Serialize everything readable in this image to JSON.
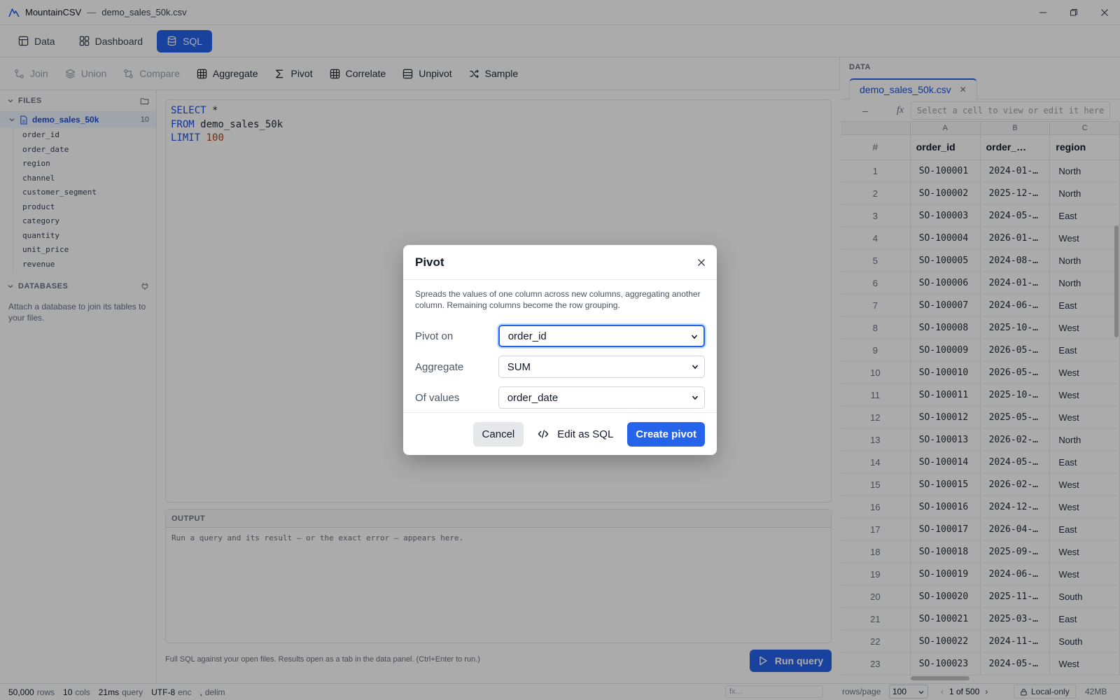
{
  "titlebar": {
    "app_name": "MountainCSV",
    "separator": "—",
    "file_name": "demo_sales_50k.csv"
  },
  "main_tabs": [
    {
      "label": "Data",
      "icon": "table-icon",
      "active": false
    },
    {
      "label": "Dashboard",
      "icon": "dashboard-icon",
      "active": false
    },
    {
      "label": "SQL",
      "icon": "database-icon",
      "active": true
    }
  ],
  "toolbar": {
    "join": "Join",
    "union": "Union",
    "compare": "Compare",
    "aggregate": "Aggregate",
    "pivot": "Pivot",
    "correlate": "Correlate",
    "unpivot": "Unpivot",
    "sample": "Sample"
  },
  "sidebar": {
    "files_header": "FILES",
    "file": {
      "name": "demo_sales_50k",
      "count": "10"
    },
    "columns": [
      "order_id",
      "order_date",
      "region",
      "channel",
      "customer_segment",
      "product",
      "category",
      "quantity",
      "unit_price",
      "revenue"
    ],
    "databases_header": "DATABASES",
    "databases_note": "Attach a database to join its tables to your files."
  },
  "editor": {
    "line1_kw": "SELECT",
    "line1_rest": " *",
    "line2_kw": "FROM",
    "line2_rest": " demo_sales_50k",
    "line3_kw": "LIMIT",
    "line3_num": "100"
  },
  "output": {
    "header": "OUTPUT",
    "empty_text": "Run a query and its result — or the exact error — appears here."
  },
  "hint": "Full SQL against your open files. Results open as a tab in the data panel. (Ctrl+Enter to run.)",
  "run_button": "Run query",
  "data_panel": {
    "header": "DATA",
    "file_tab": "demo_sales_50k.csv",
    "cell_ref": "–",
    "fx": "fx",
    "formula_placeholder": "Select a cell to view or edit it here",
    "col_letters": [
      "A",
      "B",
      "C"
    ],
    "row_header": "#",
    "columns": [
      "order_id",
      "order_…",
      "region"
    ],
    "rows": [
      [
        "1",
        "SO-100001",
        "2024-01-…",
        "North"
      ],
      [
        "2",
        "SO-100002",
        "2025-12-…",
        "North"
      ],
      [
        "3",
        "SO-100003",
        "2024-05-…",
        "East"
      ],
      [
        "4",
        "SO-100004",
        "2026-01-…",
        "West"
      ],
      [
        "5",
        "SO-100005",
        "2024-08-…",
        "North"
      ],
      [
        "6",
        "SO-100006",
        "2024-01-…",
        "North"
      ],
      [
        "7",
        "SO-100007",
        "2024-06-…",
        "East"
      ],
      [
        "8",
        "SO-100008",
        "2025-10-…",
        "West"
      ],
      [
        "9",
        "SO-100009",
        "2026-05-…",
        "East"
      ],
      [
        "10",
        "SO-100010",
        "2026-05-…",
        "West"
      ],
      [
        "11",
        "SO-100011",
        "2025-10-…",
        "West"
      ],
      [
        "12",
        "SO-100012",
        "2025-05-…",
        "West"
      ],
      [
        "13",
        "SO-100013",
        "2026-02-…",
        "North"
      ],
      [
        "14",
        "SO-100014",
        "2024-05-…",
        "East"
      ],
      [
        "15",
        "SO-100015",
        "2026-02-…",
        "West"
      ],
      [
        "16",
        "SO-100016",
        "2024-12-…",
        "West"
      ],
      [
        "17",
        "SO-100017",
        "2026-04-…",
        "East"
      ],
      [
        "18",
        "SO-100018",
        "2025-09-…",
        "West"
      ],
      [
        "19",
        "SO-100019",
        "2024-06-…",
        "West"
      ],
      [
        "20",
        "SO-100020",
        "2025-11-…",
        "South"
      ],
      [
        "21",
        "SO-100021",
        "2025-03-…",
        "East"
      ],
      [
        "22",
        "SO-100022",
        "2024-11-…",
        "South"
      ],
      [
        "23",
        "SO-100023",
        "2024-05-…",
        "West"
      ]
    ]
  },
  "statusbar": {
    "rows_value": "50,000",
    "rows_label": "rows",
    "cols_value": "10",
    "cols_label": "cols",
    "query_value": "21ms",
    "query_label": "query",
    "enc_value": "UTF-8",
    "enc_label": "enc",
    "delim_value": ",",
    "delim_label": "delim",
    "fx_placeholder": "fx…",
    "rows_per_page_label": "rows/page",
    "rows_per_page": "100",
    "page": "1 of 500",
    "local": "Local-only",
    "memory": "42MB"
  },
  "modal": {
    "title": "Pivot",
    "description": "Spreads the values of one column across new columns, aggregating another column. Remaining columns become the row grouping.",
    "pivot_on_label": "Pivot on",
    "pivot_on_value": "order_id",
    "aggregate_label": "Aggregate",
    "aggregate_value": "SUM",
    "of_values_label": "Of values",
    "of_values_value": "order_date",
    "cancel": "Cancel",
    "edit_sql": "Edit as SQL",
    "create": "Create pivot"
  },
  "colors": {
    "accent": "#2563eb",
    "overlay": "rgba(0,0,0,0.33)"
  }
}
